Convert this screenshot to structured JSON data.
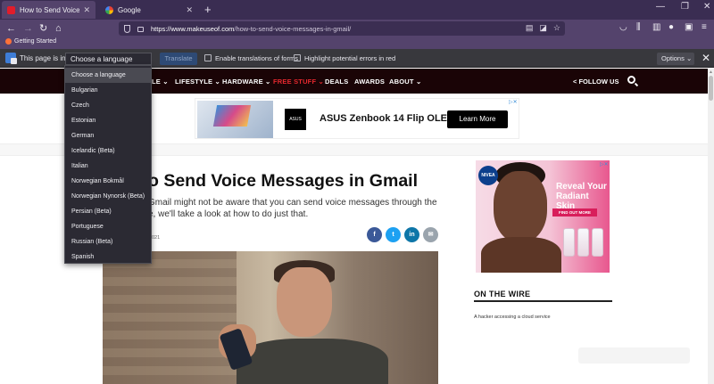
{
  "tabs": [
    {
      "title": "How to Send Voice Messages in Gmail",
      "active": true,
      "favicon": "muo-favicon"
    },
    {
      "title": "Google",
      "active": false,
      "favicon": "google-favicon"
    }
  ],
  "address_bar": {
    "url_host": "https://www.makeuseof.com",
    "url_path": "/how-to-send-voice-messages-in-gmail/"
  },
  "bookmarks": [
    "Getting Started"
  ],
  "translation_bar": {
    "label": "This page is in",
    "selected_language": "Choose a language",
    "translate_button": "Translate",
    "enable_forms_label": "Enable translations of forms",
    "highlight_errors_label": "Highlight potential errors in red",
    "options_button": "Options"
  },
  "language_dropdown": {
    "options": [
      "Choose a language",
      "Bulgarian",
      "Czech",
      "Estonian",
      "German",
      "Icelandic (Beta)",
      "Italian",
      "Norwegian Bokmål",
      "Norwegian Nynorsk (Beta)",
      "Persian (Beta)",
      "Portuguese",
      "Russian (Beta)",
      "Spanish"
    ],
    "highlighted_index": 0
  },
  "site_nav": {
    "items": [
      {
        "label": "LE ⌄",
        "red": false
      },
      {
        "label": "LIFESTYLE ⌄",
        "red": false
      },
      {
        "label": "HARDWARE ⌄",
        "red": false
      },
      {
        "label": "FREE STUFF ⌄",
        "red": true
      },
      {
        "label": "DEALS",
        "red": false
      },
      {
        "label": "AWARDS",
        "red": false
      },
      {
        "label": "ABOUT ⌄",
        "red": false
      }
    ],
    "follow_us": "FOLLOW US"
  },
  "top_ad": {
    "logo": "ASUS",
    "headline": "ASUS Zenbook 14 Flip OLED",
    "cta": "Learn More"
  },
  "article": {
    "title": "o Send Voice Messages in Gmail",
    "subtitle_line1": "Gmail might not be aware that you can send voice messages through the",
    "subtitle_line2": "e, we'll take a look at how to do just that.",
    "date_fragment": "021",
    "share": [
      "f",
      "t",
      "in",
      "✉"
    ]
  },
  "side_ad": {
    "brand": "NIVEA",
    "headline_line1": "Reveal Your",
    "headline_line2": "Radiant Skin",
    "cta": "FIND OUT MORE"
  },
  "sidebar": {
    "section_title": "ON THE WIRE",
    "item": "A hacker accessing a cloud service"
  },
  "colors": {
    "tabstrip": "#3a2d52",
    "toolbar": "#54436c",
    "site_header": "#1a0406",
    "accent_red": "#e4282e"
  }
}
